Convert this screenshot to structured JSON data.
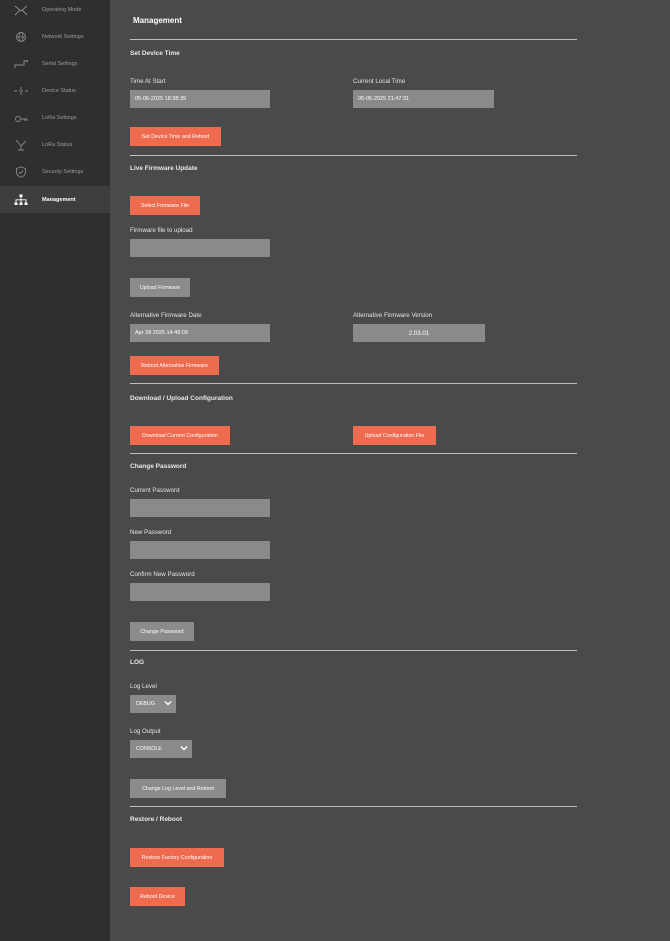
{
  "sidebar": {
    "items": [
      {
        "label": "Operating Mode",
        "icon": "operating-mode-icon"
      },
      {
        "label": "Network Settings",
        "icon": "globe-icon"
      },
      {
        "label": "Serial Settings",
        "icon": "serial-icon"
      },
      {
        "label": "Device Status",
        "icon": "device-status-icon"
      },
      {
        "label": "LoRa Settings",
        "icon": "lora-settings-icon"
      },
      {
        "label": "LoRa Status",
        "icon": "lora-status-icon"
      },
      {
        "label": "Security Settings",
        "icon": "shield-icon"
      },
      {
        "label": "Management",
        "icon": "network-tree-icon",
        "active": true
      }
    ]
  },
  "page": {
    "title": "Management"
  },
  "device_time": {
    "title": "Set Device Time",
    "time_at_start_label": "Time At Start",
    "time_at_start_value": "05-05-2025 18:38:39",
    "current_local_time_label": "Current Local Time",
    "current_local_time_value": "05-05-2025 21:47:31",
    "set_button": "Set Device Time and Reboot"
  },
  "firmware": {
    "title": "Live Firmware Update",
    "select_button": "Select Firmware File",
    "file_label": "Firmware file to upload",
    "file_value": "",
    "upload_button": "Upload Firmware",
    "alt_date_label": "Alternative Firmware Date",
    "alt_date_value": "Apr 28 2025 14:48:09",
    "alt_version_label": "Alternative Firmware Version",
    "alt_version_value": "2.03.01",
    "reboot_alt_button": "Reboot Alternative Firmware"
  },
  "config": {
    "title": "Download / Upload Configuration",
    "download_button": "Download Current Configuration",
    "upload_button": "Upload Configuration File"
  },
  "password": {
    "title": "Change Password",
    "current_label": "Current Password",
    "new_label": "New Password",
    "confirm_label": "Confirm New Password",
    "change_button": "Change Password"
  },
  "log": {
    "title": "LOG",
    "level_label": "Log Level",
    "level_value": "DEBUG",
    "output_label": "Log Output",
    "output_value": "CONSOLE",
    "change_button": "Change Log Level and Reboot"
  },
  "restore": {
    "title": "Restore / Reboot",
    "factory_button": "Restore Factory Configuration",
    "reboot_button": "Reboot Device"
  },
  "colors": {
    "accent": "#ef6b4f",
    "sidebar_bg": "#2f2f2f",
    "main_bg": "#4a4a4a",
    "field_bg": "#8a8a8a"
  }
}
